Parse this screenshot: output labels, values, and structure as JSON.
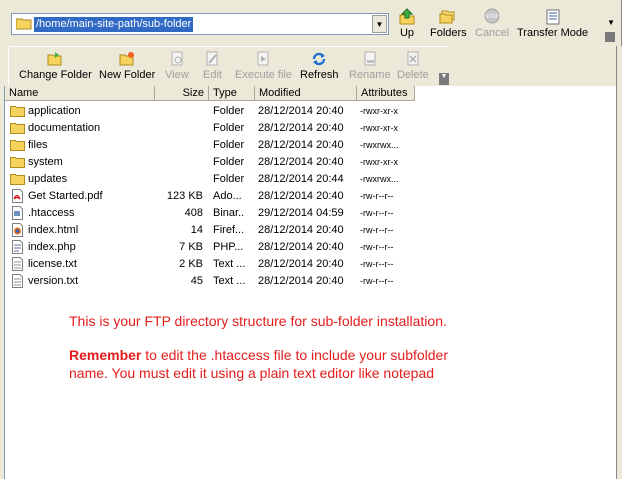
{
  "path": {
    "value": "/home/main-site-path/sub-folder",
    "dropdown_glyph": "▼"
  },
  "top_toolbar": {
    "up_label": "Up",
    "folders_label": "Folders",
    "cancel_label": "Cancel",
    "transfer_mode_label": "Transfer Mode"
  },
  "toolbar": {
    "change_folder_label": "Change Folder",
    "new_folder_label": "New Folder",
    "view_label": "View",
    "edit_label": "Edit",
    "execute_file_label": "Execute file",
    "refresh_label": "Refresh",
    "rename_label": "Rename",
    "delete_label": "Delete"
  },
  "columns": {
    "name": "Name",
    "size": "Size",
    "type": "Type",
    "modified": "Modified",
    "attributes": "Attributes"
  },
  "files": [
    {
      "icon": "folder-icon",
      "name": "application",
      "size": "",
      "type": "Folder",
      "modified": "28/12/2014 20:40",
      "attributes": "-rwxr-xr-x"
    },
    {
      "icon": "folder-icon",
      "name": "documentation",
      "size": "",
      "type": "Folder",
      "modified": "28/12/2014 20:40",
      "attributes": "-rwxr-xr-x"
    },
    {
      "icon": "folder-icon",
      "name": "files",
      "size": "",
      "type": "Folder",
      "modified": "28/12/2014 20:40",
      "attributes": "-rwxrwx..."
    },
    {
      "icon": "folder-icon",
      "name": "system",
      "size": "",
      "type": "Folder",
      "modified": "28/12/2014 20:40",
      "attributes": "-rwxr-xr-x"
    },
    {
      "icon": "folder-icon",
      "name": "updates",
      "size": "",
      "type": "Folder",
      "modified": "28/12/2014 20:44",
      "attributes": "-rwxrwx..."
    },
    {
      "icon": "pdf-icon",
      "name": "Get Started.pdf",
      "size": "123 KB",
      "type": "Ado...",
      "modified": "28/12/2014 20:40",
      "attributes": "-rw-r--r--"
    },
    {
      "icon": "file-icon",
      "name": ".htaccess",
      "size": "408",
      "type": "Binar...",
      "modified": "29/12/2014 04:59",
      "attributes": "-rw-r--r--"
    },
    {
      "icon": "html-icon",
      "name": "index.html",
      "size": "14",
      "type": "Firef...",
      "modified": "28/12/2014 20:40",
      "attributes": "-rw-r--r--"
    },
    {
      "icon": "php-icon",
      "name": "index.php",
      "size": "7 KB",
      "type": "PHP...",
      "modified": "28/12/2014 20:40",
      "attributes": "-rw-r--r--"
    },
    {
      "icon": "text-icon",
      "name": "license.txt",
      "size": "2 KB",
      "type": "Text ...",
      "modified": "28/12/2014 20:40",
      "attributes": "-rw-r--r--"
    },
    {
      "icon": "text-icon",
      "name": "version.txt",
      "size": "45",
      "type": "Text ...",
      "modified": "28/12/2014 20:40",
      "attributes": "-rw-r--r--"
    }
  ],
  "notes": {
    "line1": "This is your FTP directory structure for sub-folder installation.",
    "remember_word": "Remember",
    "line2_rest": " to edit the .htaccess file to include your subfolder",
    "line3": "name. You must edit it using a plain text editor like notepad"
  },
  "colors": {
    "note_red": "#e31c1c",
    "selection_blue": "#316ac5",
    "toolbar_bg": "#ece9d8"
  }
}
